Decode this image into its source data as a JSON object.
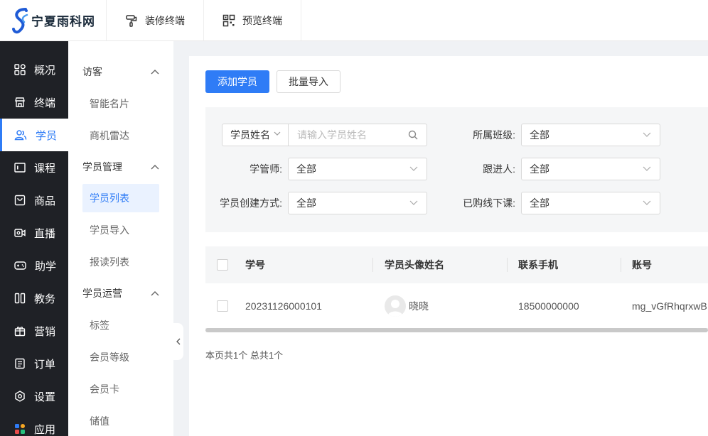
{
  "brand": {
    "name": "宁夏雨科网"
  },
  "topbar": {
    "tabs": [
      {
        "label": "装修终端",
        "icon": "paint-roller-icon"
      },
      {
        "label": "预览终端",
        "icon": "qrcode-icon"
      }
    ]
  },
  "nav1": {
    "items": [
      {
        "label": "概况",
        "icon": "dashboard-grid-icon"
      },
      {
        "label": "终端",
        "icon": "store-icon"
      },
      {
        "label": "学员",
        "icon": "users-icon",
        "active": true
      },
      {
        "label": "课程",
        "icon": "course-icon"
      },
      {
        "label": "商品",
        "icon": "goods-icon"
      },
      {
        "label": "直播",
        "icon": "live-camera-icon"
      },
      {
        "label": "助学",
        "icon": "gamepad-icon"
      },
      {
        "label": "教务",
        "icon": "book-icon"
      },
      {
        "label": "营销",
        "icon": "gift-icon"
      },
      {
        "label": "订单",
        "icon": "order-icon"
      },
      {
        "label": "设置",
        "icon": "settings-icon"
      },
      {
        "label": "应用",
        "icon": "apps-icon"
      }
    ]
  },
  "nav2": {
    "groups": [
      {
        "label": "访客",
        "items": [
          "智能名片",
          "商机雷达"
        ]
      },
      {
        "label": "学员管理",
        "items": [
          "学员列表",
          "学员导入",
          "报读列表"
        ],
        "active_index": 0
      },
      {
        "label": "学员运营",
        "items": [
          "标签",
          "会员等级",
          "会员卡",
          "储值"
        ]
      }
    ]
  },
  "toolbar": {
    "add_label": "添加学员",
    "import_label": "批量导入"
  },
  "filters": {
    "search_type": "学员姓名",
    "search_placeholder": "请输入学员姓名",
    "class_label": "所属班级:",
    "class_value": "全部",
    "manager_label": "学管师:",
    "manager_value": "全部",
    "follower_label": "跟进人:",
    "follower_value": "全部",
    "create_label": "学员创建方式:",
    "create_value": "全部",
    "offline_label": "已购线下课:",
    "offline_value": "全部"
  },
  "table": {
    "headers": [
      "学号",
      "学员头像姓名",
      "联系手机",
      "账号"
    ],
    "rows": [
      {
        "id": "20231126000101",
        "name": "晓晓",
        "phone": "18500000000",
        "account": "mg_vGfRhqrxwB"
      }
    ]
  },
  "pager": {
    "text": "本页共1个 总共1个"
  },
  "colors": {
    "accent": "#2f7cf6",
    "sidebar": "#1f2126",
    "page_bg": "#f0f2f5"
  }
}
